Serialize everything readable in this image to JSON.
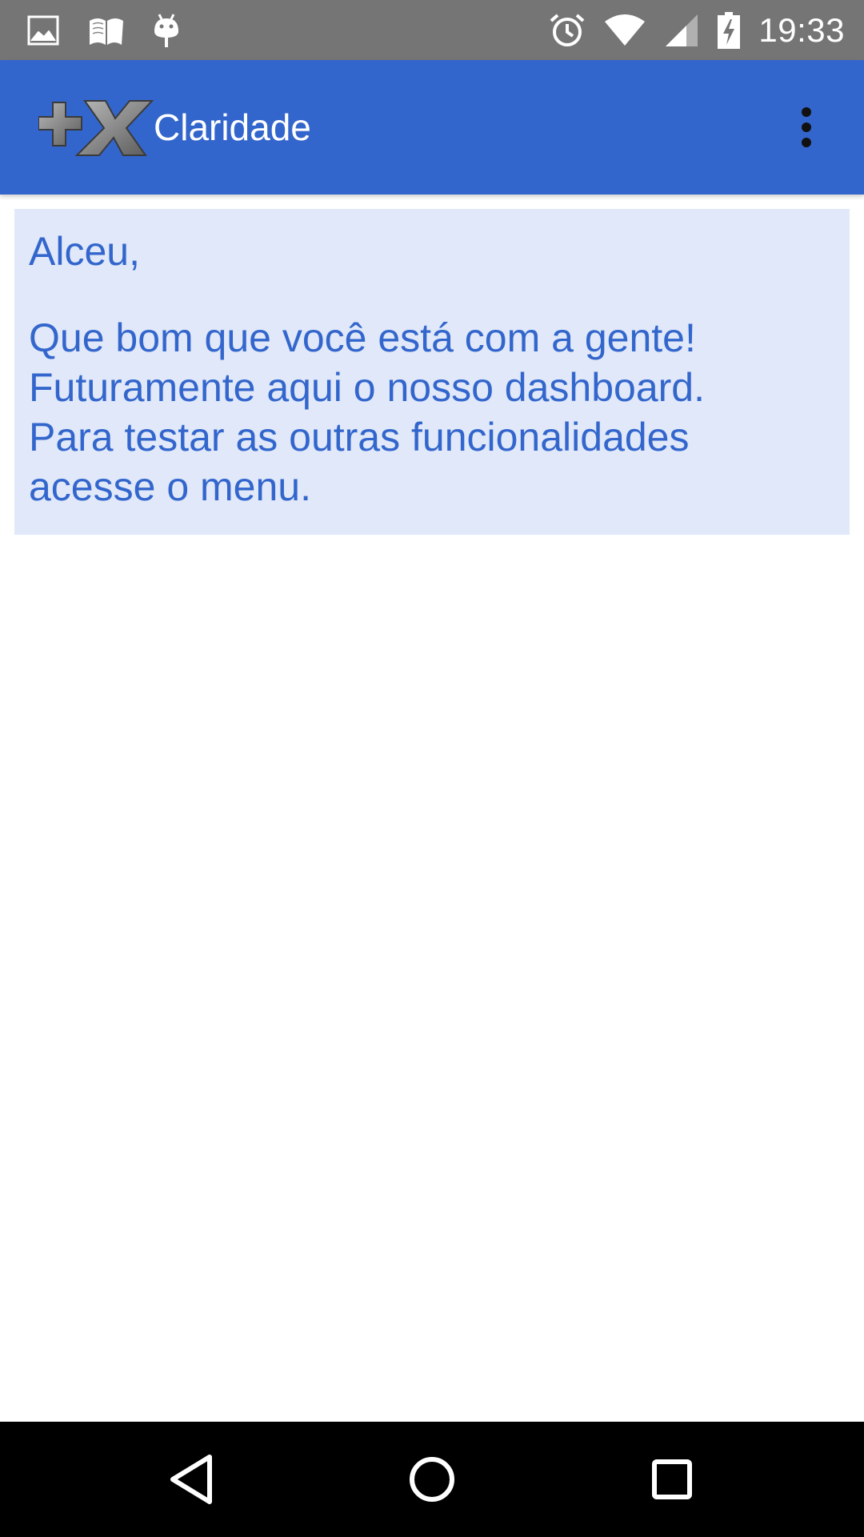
{
  "status_bar": {
    "time": "19:33",
    "left_icons": [
      "image-icon",
      "book-icon",
      "android-icon"
    ],
    "right_icons": [
      "alarm-icon",
      "wifi-icon",
      "signal-icon",
      "battery-charging-icon"
    ]
  },
  "app_bar": {
    "title": "Claridade",
    "logo": "plus-x-logo",
    "menu_icon": "overflow-menu-icon"
  },
  "welcome": {
    "greeting": "Alceu,",
    "lines": [
      "Que bom que você está com a gente!",
      "Futuramente aqui o nosso dashboard.",
      "Para testar as outras funcionalidades",
      "acesse o menu."
    ]
  },
  "nav_bar": {
    "buttons": [
      "back-icon",
      "home-icon",
      "recents-icon"
    ]
  },
  "colors": {
    "primary": "#3366cc",
    "status_bar": "#757575",
    "card_background": "#e0e8f9",
    "nav_bar": "#000000"
  }
}
